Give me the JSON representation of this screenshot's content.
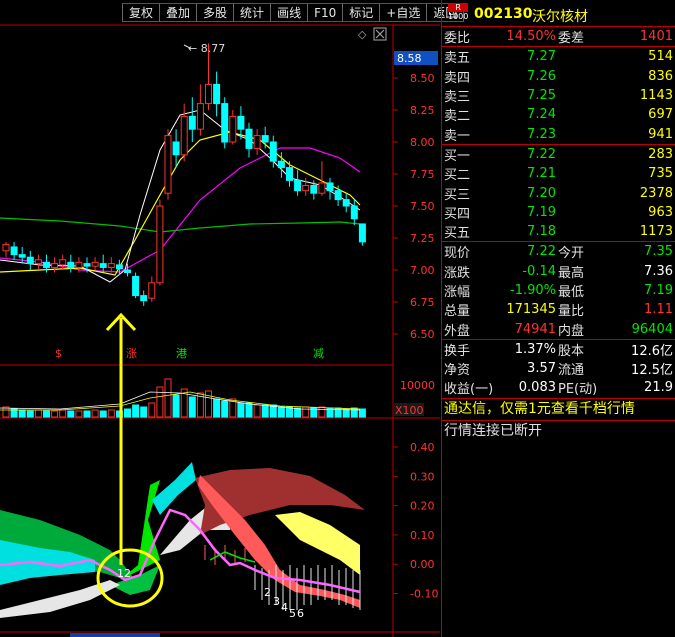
{
  "toolbar": [
    "复权",
    "叠加",
    "多股",
    "统计",
    "画线",
    "F10",
    "标记",
    "+自选",
    "返回"
  ],
  "chart": {
    "high_marker": "8.77",
    "current_price_tag": "8.58",
    "price_axis": [
      "8.50",
      "8.25",
      "8.00",
      "7.75",
      "7.50",
      "7.25",
      "7.00",
      "6.75",
      "6.50"
    ],
    "volume_axis": [
      "10000",
      "X100"
    ],
    "indicator_axis": [
      "0.40",
      "0.30",
      "0.20",
      "0.10",
      "0.00",
      "-0.10"
    ],
    "event_markers": [
      "$",
      "涨",
      "港",
      "减"
    ],
    "annotation_circle_labels": [
      "1",
      "2"
    ],
    "annotation_lower_labels": [
      "2",
      "3",
      "4",
      "5",
      "6"
    ],
    "colors": {
      "up": "#ff3232",
      "down": "#00ffff",
      "ma5": "#ffffff",
      "ma10": "#ffff00",
      "ma20": "#ff00ff",
      "ma60": "#00c000",
      "arrow": "#ffff00"
    }
  },
  "stock": {
    "badge_top": "R",
    "badge_bottom": "1000",
    "code": "002130",
    "name": "沃尔核材"
  },
  "weibi": {
    "label": "委比",
    "value": "14.50%",
    "label2": "委差",
    "value2": "1401"
  },
  "asks": [
    {
      "label": "卖五",
      "price": "7.27",
      "vol": "514"
    },
    {
      "label": "卖四",
      "price": "7.26",
      "vol": "836"
    },
    {
      "label": "卖三",
      "price": "7.25",
      "vol": "1143"
    },
    {
      "label": "卖二",
      "price": "7.24",
      "vol": "697"
    },
    {
      "label": "卖一",
      "price": "7.23",
      "vol": "941"
    }
  ],
  "bids": [
    {
      "label": "买一",
      "price": "7.22",
      "vol": "283"
    },
    {
      "label": "买二",
      "price": "7.21",
      "vol": "735"
    },
    {
      "label": "买三",
      "price": "7.20",
      "vol": "2378"
    },
    {
      "label": "买四",
      "price": "7.19",
      "vol": "963"
    },
    {
      "label": "买五",
      "price": "7.18",
      "vol": "1173"
    }
  ],
  "quote": [
    {
      "l1": "现价",
      "v1": "7.22",
      "c1": "green",
      "l2": "今开",
      "v2": "7.35",
      "c2": "green"
    },
    {
      "l1": "涨跌",
      "v1": "-0.14",
      "c1": "green",
      "l2": "最高",
      "v2": "7.36",
      "c2": "white"
    },
    {
      "l1": "涨幅",
      "v1": "-1.90%",
      "c1": "green",
      "l2": "最低",
      "v2": "7.19",
      "c2": "green"
    },
    {
      "l1": "总量",
      "v1": "171345",
      "c1": "yellow",
      "l2": "量比",
      "v2": "1.11",
      "c2": "red"
    },
    {
      "l1": "外盘",
      "v1": "74941",
      "c1": "red",
      "l2": "内盘",
      "v2": "96404",
      "c2": "green"
    }
  ],
  "fundamentals": [
    {
      "l1": "换手",
      "v1": "1.37%",
      "l2": "股本",
      "v2": "12.6亿"
    },
    {
      "l1": "净资",
      "v1": "3.57",
      "l2": "流通",
      "v2": "12.5亿"
    },
    {
      "l1": "收益(一)",
      "v1": "0.083",
      "l2": "PE(动)",
      "v2": "21.9"
    }
  ],
  "notices": [
    "通达信，仅需1元查看千档行情",
    "行情连接已断开"
  ]
}
